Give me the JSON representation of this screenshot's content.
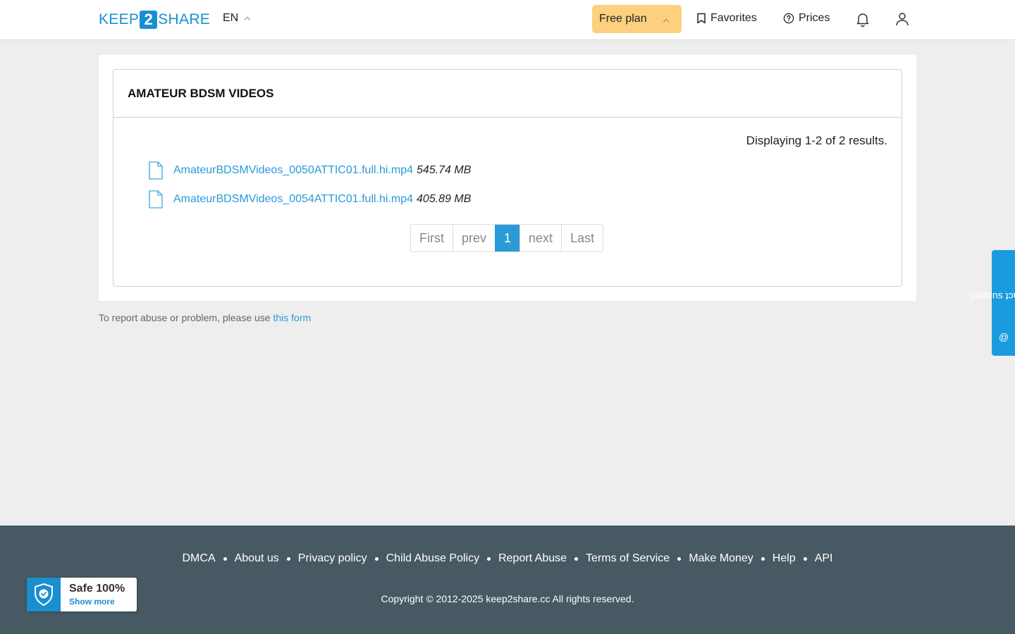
{
  "header": {
    "logo_left": "KEEP",
    "logo_mid": "2",
    "logo_right": "SHARE",
    "language": "EN",
    "plan_label": "Free plan",
    "favorites_label": "Favorites",
    "prices_label": "Prices"
  },
  "main": {
    "title": "AMATEUR BDSM VIDEOS",
    "summary": "Displaying 1-2 of 2 results.",
    "files": [
      {
        "name": "AmateurBDSMVideos_0050ATTIC01.full.hi.mp4",
        "size": "545.74 MB"
      },
      {
        "name": "AmateurBDSMVideos_0054ATTIC01.full.hi.mp4",
        "size": "405.89 MB"
      }
    ],
    "pager": {
      "first": "First",
      "prev": "prev",
      "current": "1",
      "next": "next",
      "last": "Last"
    }
  },
  "report": {
    "text": "To report abuse or problem, please use",
    "link": "this form"
  },
  "support": {
    "label": "contact support"
  },
  "footer": {
    "links": [
      "DMCA",
      "About us",
      "Privacy policy",
      "Child Abuse Policy",
      "Report Abuse",
      "Terms of Service",
      "Make Money",
      "Help",
      "API"
    ],
    "copyright": "Copyright © 2012-2025 keep2share.cc All rights reserved."
  },
  "badge": {
    "title": "Safe 100%",
    "link": "Show more"
  },
  "colors": {
    "accent": "#2a9bd6",
    "plan": "#fcd07e",
    "footer": "#475a64"
  }
}
